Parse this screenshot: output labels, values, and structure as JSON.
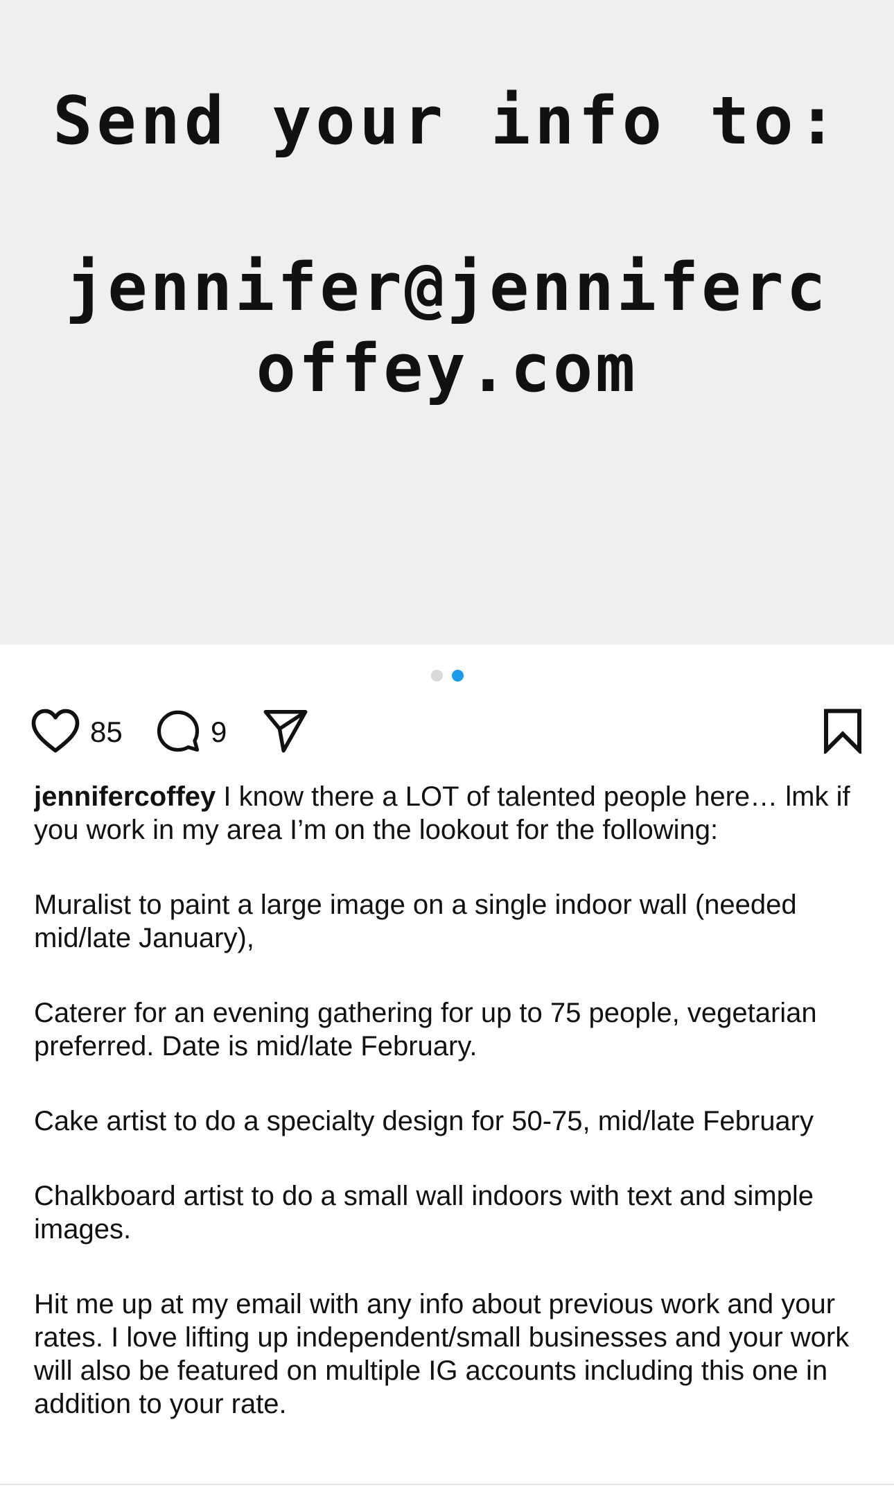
{
  "post_image": {
    "line1": "Send your info to:",
    "line2": "jennifer@jenniferc",
    "line3": "offey.com"
  },
  "carousel": {
    "total": 2,
    "active_index": 2
  },
  "actions": {
    "likes": "85",
    "comments": "9"
  },
  "icons": {
    "like": "heart-icon",
    "comment": "comment-bubble-icon",
    "share": "send-paper-plane-icon",
    "save": "bookmark-icon"
  },
  "caption": {
    "username": "jennifercoffey",
    "intro": " I know there a LOT of talented people here… lmk if you work in my area I’m on the lookout for the following:",
    "p1": "Muralist to paint a large image on a single indoor wall (needed mid/late January),",
    "p2": "Caterer for an evening gathering for up to 75 people, vegetarian preferred. Date is mid/late February.",
    "p3": "Cake artist to do a specialty design for 50-75, mid/late February",
    "p4": "Chalkboard artist to do a small wall indoors with text and simple images.",
    "p5": "Hit me up at my email with any info about previous work and your rates. I love lifting up independent/small businesses and your work will also be featured on multiple IG accounts including this one in addition to your rate."
  },
  "colors": {
    "image_bg": "#efefef",
    "active_dot": "#1a9bf0",
    "inactive_dot": "#d9d9d9",
    "text": "#111111"
  }
}
